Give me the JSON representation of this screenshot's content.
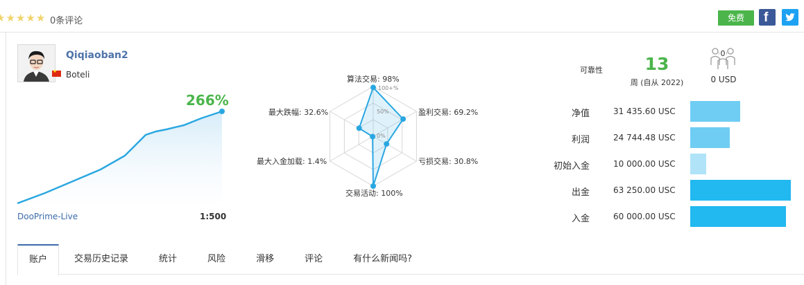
{
  "rating": {
    "stars": 5,
    "review_count_label": "0条评论"
  },
  "actions": {
    "free_label": "免费",
    "facebook_icon": "facebook-icon",
    "twitter_icon": "twitter-icon"
  },
  "profile": {
    "username": "Qiqiaoban2",
    "display_name": "Boteli",
    "flag": "china-flag-icon"
  },
  "growth": {
    "value_label": "266%",
    "broker": "DooPrime-Live",
    "leverage": "1:500"
  },
  "radar": {
    "center_label": "0%",
    "mid_label": "50%",
    "outer_label": "100+%",
    "axes": [
      {
        "label": "算法交易: 98%",
        "value": 98
      },
      {
        "label": "盈利交易: 69.2%",
        "value": 69.2
      },
      {
        "label": "亏损交易: 30.8%",
        "value": 30.8
      },
      {
        "label": "交易活动: 100%",
        "value": 100
      },
      {
        "label": "最大入金加载: 1.4%",
        "value": 1.4
      },
      {
        "label": "最大跌幅: 32.6%",
        "value": 32.6
      }
    ]
  },
  "reliability": {
    "label": "可靠性",
    "weeks": "13",
    "since": "周 (自从 2022)"
  },
  "subscribers": {
    "count": "0",
    "price": "0 USD"
  },
  "financials": [
    {
      "label": "净值",
      "value": "31 435.60 USC",
      "amount": 31435.6,
      "color": "#6fcdf3"
    },
    {
      "label": "利润",
      "value": "24 744.48 USC",
      "amount": 24744.48,
      "color": "#6fcdf3"
    },
    {
      "label": "初始入金",
      "value": "10 000.00 USC",
      "amount": 10000.0,
      "color": "#b0e3f8"
    },
    {
      "label": "出金",
      "value": "63 250.00 USC",
      "amount": 63250.0,
      "color": "#22b8f0"
    },
    {
      "label": "入金",
      "value": "60 000.00 USC",
      "amount": 60000.0,
      "color": "#22b8f0"
    }
  ],
  "tabs": [
    {
      "label": "账户",
      "active": true
    },
    {
      "label": "交易历史记录"
    },
    {
      "label": "统计"
    },
    {
      "label": "风险"
    },
    {
      "label": "滑移"
    },
    {
      "label": "评论"
    },
    {
      "label": "有什么新闻吗?"
    }
  ]
}
